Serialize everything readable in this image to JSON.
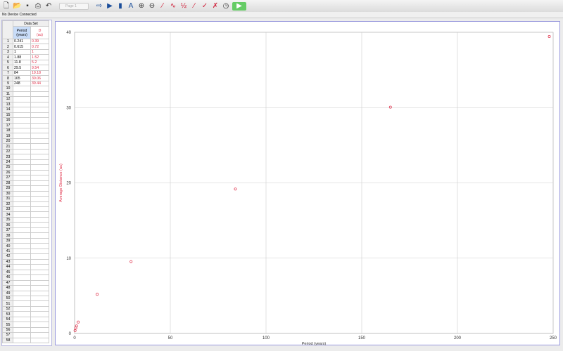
{
  "toolbar": {
    "page_select": "Page 1",
    "icons": [
      "new-file-icon",
      "open-folder-icon",
      "save-icon",
      "print-icon",
      "undo-icon",
      "page-forward-icon",
      "step-icon",
      "sensor-icon",
      "autoscale-icon",
      "zoom-in-icon",
      "zoom-out-icon",
      "tangent-icon",
      "curve-fit-icon",
      "integral-icon",
      "slope-icon",
      "linear-fit-icon",
      "model-icon",
      "stopwatch-icon",
      "collect-icon"
    ]
  },
  "status": "No Device Connected",
  "table": {
    "title": "Data Set",
    "col1": "Period",
    "col1_unit": "(years)",
    "col2": "D",
    "col2_unit": "(au)",
    "row_count": 58
  },
  "chart_data": {
    "type": "scatter",
    "xlabel": "Period (years)",
    "ylabel": "Average Distance (au)",
    "xlim": [
      0,
      250
    ],
    "ylim": [
      0,
      40
    ],
    "xticks": [
      0,
      50,
      100,
      150,
      200,
      250
    ],
    "yticks": [
      0,
      10,
      20,
      30,
      40
    ],
    "grid": true,
    "x": [
      0.241,
      0.615,
      1,
      1.88,
      11.8,
      29.5,
      84,
      165,
      248
    ],
    "y": [
      0.39,
      0.72,
      1,
      1.52,
      5.2,
      9.54,
      19.18,
      30.06,
      39.44
    ],
    "x_text": [
      "0.241",
      "0.615",
      "1",
      "1.88",
      "11.8",
      "29.5",
      "84",
      "165",
      "248"
    ],
    "y_text": [
      "0.39",
      "0.72",
      "1",
      "1.52",
      "5.2",
      "9.54",
      "19.18",
      "30.06",
      "39.44"
    ],
    "marker_color": "#e0304a"
  }
}
